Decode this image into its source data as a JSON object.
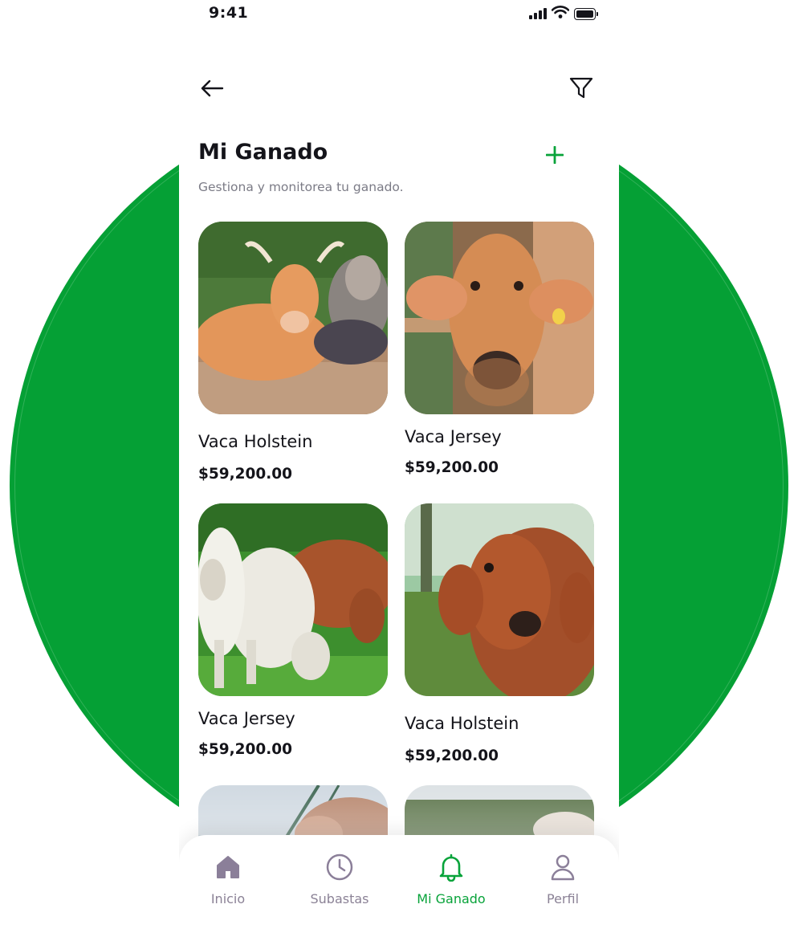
{
  "status_bar": {
    "time": "9:41"
  },
  "header": {
    "title": "Mi Ganado",
    "subtitle": "Gestiona y monitorea tu ganado."
  },
  "cattle": [
    {
      "name": "Vaca Holstein",
      "price": "$59,200.00"
    },
    {
      "name": "Vaca Jersey",
      "price": "$59,200.00"
    },
    {
      "name": "Vaca Jersey",
      "price": "$59,200.00"
    },
    {
      "name": "Vaca Holstein",
      "price": "$59,200.00"
    }
  ],
  "tab_bar": {
    "items": [
      {
        "label": "Inicio",
        "icon": "home-icon"
      },
      {
        "label": "Subastas",
        "icon": "clock-icon"
      },
      {
        "label": "Mi Ganado",
        "icon": "bell-icon",
        "active": true
      },
      {
        "label": "Perfil",
        "icon": "user-icon"
      }
    ]
  },
  "colors": {
    "brand_green": "#05a035",
    "active_tab": "#08a33a",
    "inactive_tab": "#8b8296"
  }
}
